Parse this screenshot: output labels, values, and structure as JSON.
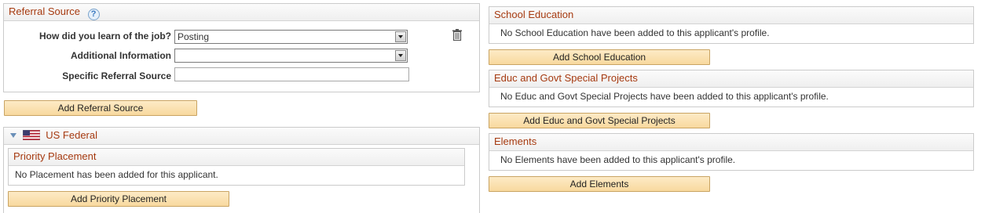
{
  "referral": {
    "title": "Referral Source",
    "help_glyph": "?",
    "fields": {
      "learn_label": "How did you learn of the job?",
      "learn_value": "Posting",
      "additional_label": "Additional Information",
      "additional_value": "",
      "specific_label": "Specific Referral Source",
      "specific_value": ""
    },
    "add_button": "Add Referral Source"
  },
  "us_federal": {
    "title": "US Federal",
    "priority": {
      "title": "Priority Placement",
      "empty_message": "No Placement has been added for this applicant.",
      "add_button": "Add Priority Placement"
    }
  },
  "school_education": {
    "title": "School Education",
    "empty_message": "No School Education have been added to this applicant's profile.",
    "add_button": "Add School Education"
  },
  "special_projects": {
    "title": "Educ and Govt Special Projects",
    "empty_message": "No Educ and Govt Special Projects have been added to this applicant's profile.",
    "add_button": "Add Educ and Govt Special Projects"
  },
  "elements": {
    "title": "Elements",
    "empty_message": "No Elements have been added to this applicant's profile.",
    "add_button": "Add Elements"
  },
  "colors": {
    "header_text": "#a63a10",
    "button_bg": "#f8d99e",
    "border": "#cbcbcb"
  },
  "icons": [
    "help-icon",
    "trash-icon",
    "collapse-triangle-icon",
    "us-flag-icon",
    "dropdown-arrow-icon"
  ]
}
